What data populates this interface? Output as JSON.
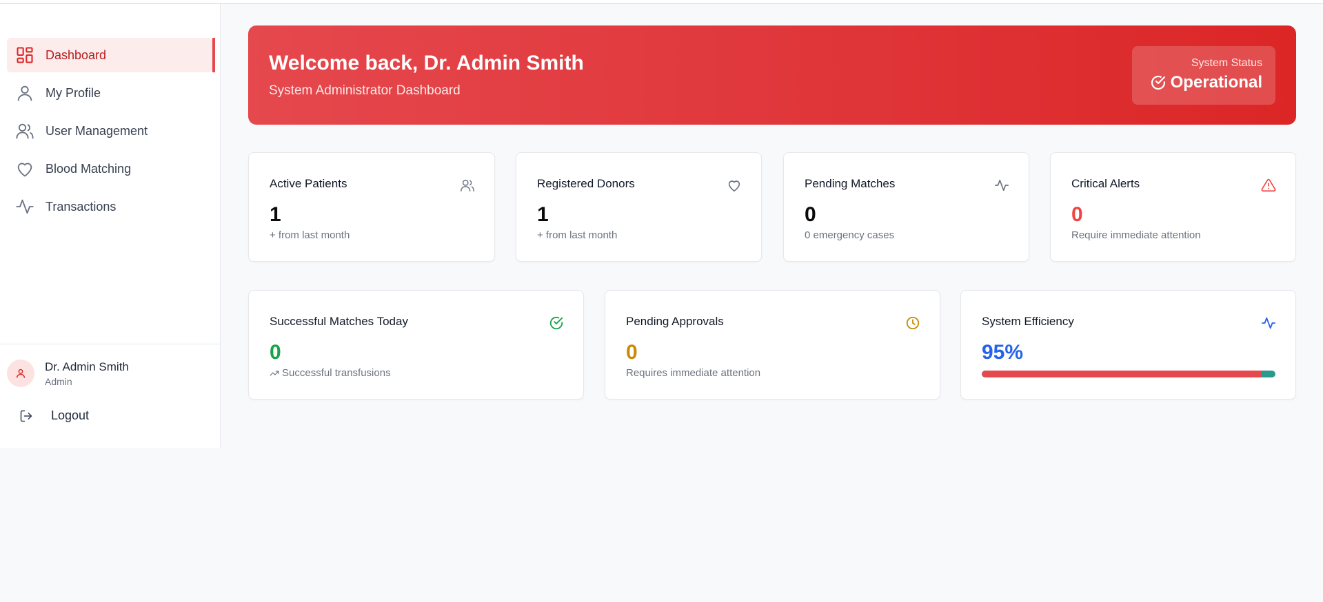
{
  "sidebar": {
    "items": [
      {
        "label": "Dashboard",
        "icon": "dashboard-grid-icon",
        "active": true
      },
      {
        "label": "My Profile",
        "icon": "user-icon"
      },
      {
        "label": "User Management",
        "icon": "users-icon"
      },
      {
        "label": "Blood Matching",
        "icon": "heart-icon"
      },
      {
        "label": "Transactions",
        "icon": "activity-icon"
      }
    ],
    "user": {
      "name": "Dr. Admin Smith",
      "role": "Admin"
    },
    "logout_label": "Logout"
  },
  "banner": {
    "title": "Welcome back, Dr. Admin Smith",
    "subtitle": "System Administrator Dashboard",
    "status_label": "System Status",
    "status_value": "Operational"
  },
  "stats": [
    {
      "title": "Active Patients",
      "value": "1",
      "sub": "+ from last month",
      "icon": "users-icon"
    },
    {
      "title": "Registered Donors",
      "value": "1",
      "sub": "+ from last month",
      "icon": "heart-icon"
    },
    {
      "title": "Pending Matches",
      "value": "0",
      "sub": "0 emergency cases",
      "icon": "activity-icon"
    },
    {
      "title": "Critical Alerts",
      "value": "0",
      "sub": "Require immediate attention",
      "icon": "alert-triangle-icon"
    }
  ],
  "summary": [
    {
      "title": "Successful Matches Today",
      "value": "0",
      "sub": "Successful transfusions",
      "icon": "check-circle-icon"
    },
    {
      "title": "Pending Approvals",
      "value": "0",
      "sub": "Requires immediate attention",
      "icon": "clock-icon"
    },
    {
      "title": "System Efficiency",
      "value": "95%",
      "progress": 0.95,
      "icon": "activity-icon"
    }
  ],
  "colors": {
    "accent": "#e5484d",
    "critical": "#ef4444",
    "success": "#16a34a",
    "warning": "#ca8a04",
    "info": "#2563eb",
    "progress_track": "#2b9a8e"
  }
}
